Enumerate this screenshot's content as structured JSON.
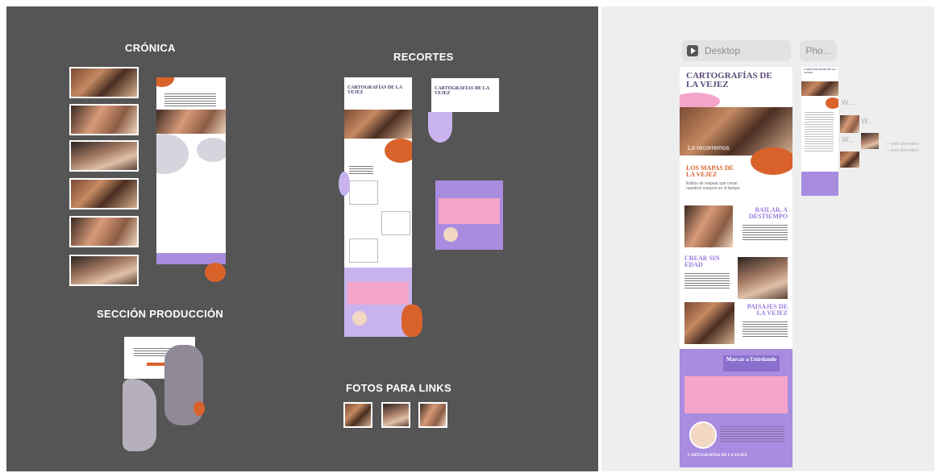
{
  "canvas": {
    "sections": {
      "cronica": "CRÓNICA",
      "recortes": "RECORTES",
      "produccion": "SECCIÓN PRODUCCIÓN",
      "fotos": "FOTOS PARA LINKS"
    },
    "recortes_header": "CARTOGRAFÍAS DE LA VEJEZ",
    "recortes_header_small": "CARTOGRAFÍAS DE LA VEJEZ"
  },
  "preview": {
    "tabs": {
      "desktop": "Desktop",
      "phone": "Pho..."
    },
    "page": {
      "title": "CARTOGRAFÍAS DE LA VEJEZ",
      "hero_caption": "Lo recorremos",
      "section1": "LOS MAPAS DE LA VEJEZ",
      "section1_text": "Estilos de mapear que crean nuestros cuerpos en el tiempo",
      "section2": "BAILAR, A DESTIEMPO",
      "section3": "CREAR SIN EDAD",
      "section4": "PAISAJES DE LA VEJEZ",
      "banner": "Marcar a Unirdando",
      "footer_title": "CARTOGRAFÍAS DE LA VEJEZ"
    },
    "phone_frame_title": "CARTOGRAFÍAS DE LA VEJEZ",
    "phone_list": [
      "W...",
      "W...",
      "W..."
    ],
    "phone_notes": [
      "— texto alternativo",
      "— texto alternativo"
    ]
  },
  "colors": {
    "canvas": "#555555",
    "purple": "#a98ce0",
    "orange": "#d9622b",
    "lilac": "#c9b3ef",
    "preview_bg": "#eeeeee"
  },
  "icons": {
    "desktop_tab": "play-icon"
  }
}
